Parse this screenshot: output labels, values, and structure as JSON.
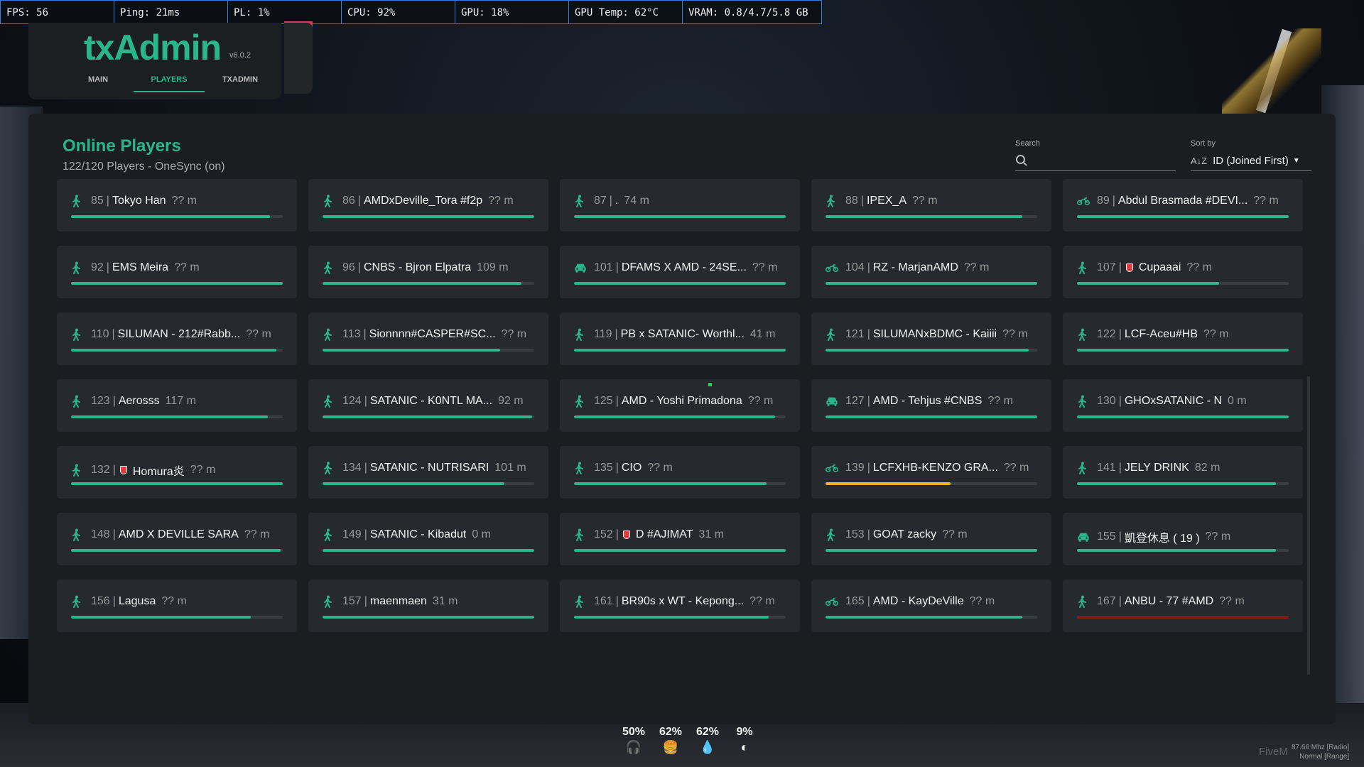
{
  "perf": {
    "fps": "FPS: 56",
    "ping": "Ping: 21ms",
    "pl": "PL: 1%",
    "cpu": "CPU: 92%",
    "gpu": "GPU: 18%",
    "gpu_temp": "GPU Temp: 62°C",
    "vram": "VRAM: 0.8/4.7/5.8 GB"
  },
  "header": {
    "logo": "txAdmin",
    "version": "v6.0.2",
    "tabs": [
      "MAIN",
      "PLAYERS",
      "TXADMIN"
    ],
    "active_tab": "PLAYERS"
  },
  "panel": {
    "title": "Online Players",
    "subtitle": "122/120 Players - OneSync (on)",
    "search_label": "Search",
    "search_value": "",
    "sort_label": "Sort by",
    "sort_value": "ID (Joined First)",
    "sort_icon": "sort-az-icon"
  },
  "colors": {
    "accent": "#2ab58a",
    "bar_warning": "#f0b429",
    "bar_danger": "#8b1a1a"
  },
  "players": [
    {
      "id": "85",
      "name": "Tokyo Han",
      "dist": "?? m",
      "icon": "walking-icon",
      "health": 0.94,
      "color": "#2ab58a",
      "badge": false
    },
    {
      "id": "86",
      "name": "AMDxDeville_Tora #f2p",
      "dist": "?? m",
      "icon": "walking-icon",
      "health": 1.0,
      "color": "#2ab58a",
      "badge": false
    },
    {
      "id": "87",
      "name": ".",
      "dist": "74 m",
      "icon": "walking-icon",
      "health": 1.0,
      "color": "#2ab58a",
      "badge": false
    },
    {
      "id": "88",
      "name": "IPEX_A",
      "dist": "?? m",
      "icon": "walking-icon",
      "health": 0.93,
      "color": "#2ab58a",
      "badge": false
    },
    {
      "id": "89",
      "name": "Abdul Brasmada #DEVI...",
      "dist": "?? m",
      "icon": "motorcycle-icon",
      "health": 1.0,
      "color": "#2ab58a",
      "badge": false
    },
    {
      "id": "92",
      "name": "EMS Meira",
      "dist": "?? m",
      "icon": "walking-icon",
      "health": 1.0,
      "color": "#2ab58a",
      "badge": false
    },
    {
      "id": "96",
      "name": "CNBS - Bjron Elpatra",
      "dist": "109 m",
      "icon": "walking-icon",
      "health": 0.94,
      "color": "#2ab58a",
      "badge": false
    },
    {
      "id": "101",
      "name": "DFAMS X AMD - 24SE...",
      "dist": "?? m",
      "icon": "car-icon",
      "health": 1.0,
      "color": "#2ab58a",
      "badge": false
    },
    {
      "id": "104",
      "name": "RZ - MarjanAMD",
      "dist": "?? m",
      "icon": "motorcycle-icon",
      "health": 1.0,
      "color": "#2ab58a",
      "badge": false
    },
    {
      "id": "107",
      "name": "Cupaaai",
      "dist": "?? m",
      "icon": "walking-icon",
      "health": 0.67,
      "color": "#2ab58a",
      "badge": true
    },
    {
      "id": "110",
      "name": "SILUMAN - 212#Rabb...",
      "dist": "?? m",
      "icon": "walking-icon",
      "health": 0.97,
      "color": "#2ab58a",
      "badge": false
    },
    {
      "id": "113",
      "name": "Sionnnn#CASPER#SC...",
      "dist": "?? m",
      "icon": "walking-icon",
      "health": 0.84,
      "color": "#2ab58a",
      "badge": false
    },
    {
      "id": "119",
      "name": "PB x SATANIC- Worthl...",
      "dist": "41 m",
      "icon": "walking-icon",
      "health": 1.0,
      "color": "#2ab58a",
      "badge": false
    },
    {
      "id": "121",
      "name": "SILUMANxBDMC - Kaiiii",
      "dist": "?? m",
      "icon": "walking-icon",
      "health": 0.96,
      "color": "#2ab58a",
      "badge": false
    },
    {
      "id": "122",
      "name": "LCF-Aceu#HB",
      "dist": "?? m",
      "icon": "walking-icon",
      "health": 1.0,
      "color": "#2ab58a",
      "badge": false
    },
    {
      "id": "123",
      "name": "Aerosss",
      "dist": "117 m",
      "icon": "walking-icon",
      "health": 0.93,
      "color": "#2ab58a",
      "badge": false
    },
    {
      "id": "124",
      "name": "SATANIC - K0NTL MA...",
      "dist": "92 m",
      "icon": "walking-icon",
      "health": 0.99,
      "color": "#2ab58a",
      "badge": false
    },
    {
      "id": "125",
      "name": "AMD - Yoshi Primadona",
      "dist": "?? m",
      "icon": "walking-icon",
      "health": 0.95,
      "color": "#2ab58a",
      "badge": false
    },
    {
      "id": "127",
      "name": "AMD - Tehjus #CNBS",
      "dist": "?? m",
      "icon": "car-icon",
      "health": 1.0,
      "color": "#2ab58a",
      "badge": false
    },
    {
      "id": "130",
      "name": "GHOxSATANIC - N",
      "dist": "0 m",
      "icon": "walking-icon",
      "health": 1.0,
      "color": "#2ab58a",
      "badge": false
    },
    {
      "id": "132",
      "name": "Homura炎",
      "dist": "?? m",
      "icon": "walking-icon",
      "health": 1.0,
      "color": "#2ab58a",
      "badge": true
    },
    {
      "id": "134",
      "name": "SATANIC - NUTRISARI",
      "dist": "101 m",
      "icon": "walking-icon",
      "health": 0.86,
      "color": "#2ab58a",
      "badge": false
    },
    {
      "id": "135",
      "name": "CIO",
      "dist": "?? m",
      "icon": "walking-icon",
      "health": 0.91,
      "color": "#2ab58a",
      "badge": false
    },
    {
      "id": "139",
      "name": "LCFXHB-KENZO GRA...",
      "dist": "?? m",
      "icon": "motorcycle-icon",
      "health": 0.59,
      "color": "#f0b429",
      "badge": false
    },
    {
      "id": "141",
      "name": "JELY DRINK",
      "dist": "82 m",
      "icon": "walking-icon",
      "health": 0.94,
      "color": "#2ab58a",
      "badge": false
    },
    {
      "id": "148",
      "name": "AMD X DEVILLE SARA",
      "dist": "?? m",
      "icon": "walking-icon",
      "health": 0.99,
      "color": "#2ab58a",
      "badge": false
    },
    {
      "id": "149",
      "name": "SATANIC - Kibadut",
      "dist": "0 m",
      "icon": "walking-icon",
      "health": 1.0,
      "color": "#2ab58a",
      "badge": false
    },
    {
      "id": "152",
      "name": "D #AJIMAT",
      "dist": "31 m",
      "icon": "walking-icon",
      "health": 1.0,
      "color": "#2ab58a",
      "badge": true
    },
    {
      "id": "153",
      "name": "GOAT zacky",
      "dist": "?? m",
      "icon": "walking-icon",
      "health": 1.0,
      "color": "#2ab58a",
      "badge": false
    },
    {
      "id": "155",
      "name": "凱登休息 ( 19 )",
      "dist": "?? m",
      "icon": "car-icon",
      "health": 0.94,
      "color": "#2ab58a",
      "badge": false
    },
    {
      "id": "156",
      "name": "Lagusa",
      "dist": "?? m",
      "icon": "walking-icon",
      "health": 0.85,
      "color": "#2ab58a",
      "badge": false
    },
    {
      "id": "157",
      "name": "maenmaen",
      "dist": "31 m",
      "icon": "walking-icon",
      "health": 1.0,
      "color": "#2ab58a",
      "badge": false
    },
    {
      "id": "161",
      "name": "BR90s x WT - Kepong...",
      "dist": "?? m",
      "icon": "walking-icon",
      "health": 0.92,
      "color": "#2ab58a",
      "badge": false
    },
    {
      "id": "165",
      "name": "AMD - KayDeVille",
      "dist": "?? m",
      "icon": "motorcycle-icon",
      "health": 0.93,
      "color": "#2ab58a",
      "badge": false
    },
    {
      "id": "167",
      "name": "ANBU - 77 #AMD",
      "dist": "?? m",
      "icon": "walking-icon",
      "health": 1.0,
      "color": "#8b1a1a",
      "badge": false
    }
  ],
  "hud": [
    {
      "value": "50%",
      "icon": "headset-icon",
      "glyph": "🎧"
    },
    {
      "value": "62%",
      "icon": "burger-icon",
      "glyph": "🍔"
    },
    {
      "value": "62%",
      "icon": "water-drop-icon",
      "glyph": "💧"
    },
    {
      "value": "9%",
      "icon": "brain-icon",
      "glyph": "◐"
    }
  ],
  "footer": {
    "brand": "FiveM",
    "radio_freq": "87.66 Mhz [Radio]",
    "radio_mode": "Normal [Range]"
  }
}
